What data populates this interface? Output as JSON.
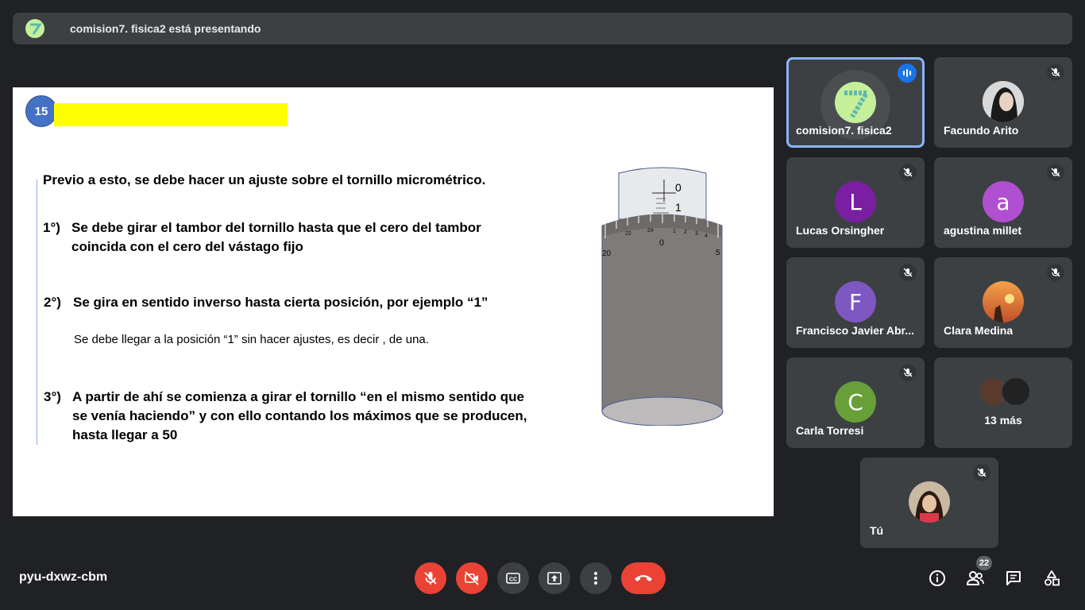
{
  "banner": {
    "presenter_text": "comision7. fisica2 está presentando"
  },
  "slide": {
    "number": "15",
    "intro": "Previo a esto, se debe hacer un ajuste sobre el tornillo micrométrico.",
    "step1_num": "1°)",
    "step1_line1": "Se debe girar el tambor del tornillo hasta que el cero del tambor",
    "step1_line2": "coincida con el cero del vástago fijo",
    "step2_num": "2°)",
    "step2_line1": "Se gira en sentido inverso hasta cierta posición, por ejemplo  “1”",
    "step2_note": "Se debe llegar a la posición “1”  sin hacer ajustes, es decir , de una.",
    "step3_num": "3°)",
    "step3_line1": "A partir de ahí se comienza a girar el tornillo “en el mismo sentido que",
    "step3_line2": "se venía haciendo” y con ello contando los máximos que se producen,",
    "step3_line3": "hasta llegar a 50",
    "micrometer": {
      "sleeve_labels": [
        "0",
        "1"
      ],
      "thimble_labels": [
        "22",
        "24",
        "0",
        "1",
        "2",
        "3",
        "4",
        "20",
        "5"
      ]
    }
  },
  "participants": [
    {
      "name": "comision7. fisica2",
      "avatar": "seven-logo",
      "status": "speaking"
    },
    {
      "name": "Facundo Arito",
      "avatar": "photo",
      "status": "muted"
    },
    {
      "name": "Lucas Orsingher",
      "initial": "L",
      "color": "#7b1fa2",
      "status": "muted"
    },
    {
      "name": "agustina millet",
      "initial": "a",
      "color": "#b04fcf",
      "status": "muted"
    },
    {
      "name": "Francisco Javier Abr...",
      "initial": "F",
      "color": "#7e57c2",
      "status": "muted"
    },
    {
      "name": "Clara Medina",
      "avatar": "photo",
      "status": "muted"
    },
    {
      "name": "Carla Torresi",
      "initial": "C",
      "color": "#689f38",
      "status": "muted"
    },
    {
      "name": "13 más",
      "avatar": "group"
    },
    {
      "name": "Tú",
      "avatar": "photo",
      "status": "muted"
    }
  ],
  "footer": {
    "meeting_code": "pyu-dxwz-cbm",
    "people_count": "22"
  },
  "colors": {
    "background": "#202124",
    "tile": "#3c4043",
    "danger": "#ea4335",
    "accent": "#8ab4f8"
  }
}
